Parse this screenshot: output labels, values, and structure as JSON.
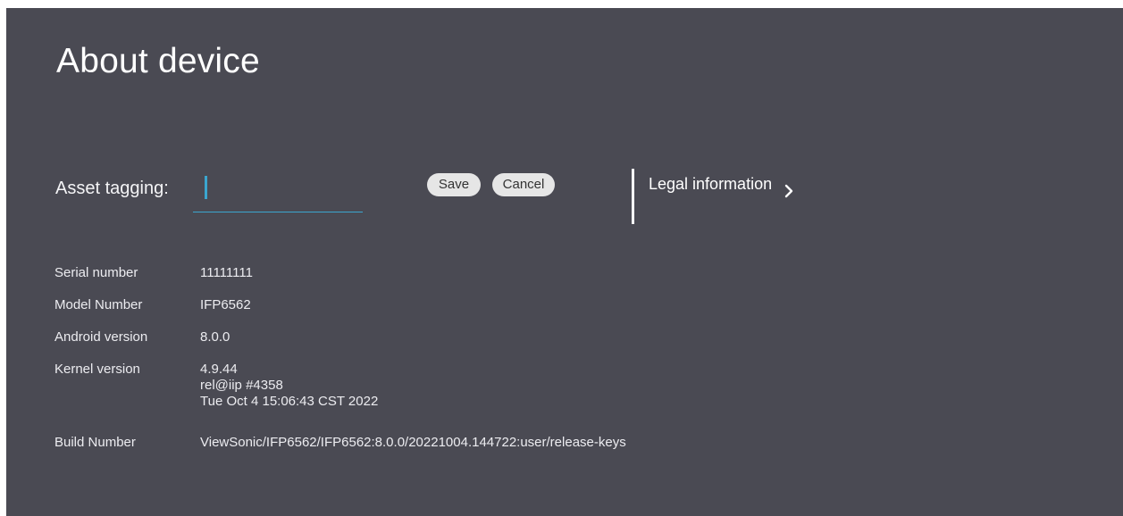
{
  "page": {
    "title": "About device"
  },
  "asset_tagging": {
    "label": "Asset tagging:",
    "value": "",
    "save_label": "Save",
    "cancel_label": "Cancel"
  },
  "legal": {
    "label": "Legal information"
  },
  "device_info": [
    {
      "key": "Serial number",
      "value": [
        "11111111"
      ]
    },
    {
      "key": "Model Number",
      "value": [
        "IFP6562"
      ]
    },
    {
      "key": "Android version",
      "value": [
        "8.0.0"
      ]
    },
    {
      "key": "Kernel version",
      "value": [
        "4.9.44",
        "rel@iip #4358",
        "Tue Oct 4 15:06:43 CST 2022"
      ]
    },
    {
      "key": "Build Number",
      "value": [
        "ViewSonic/IFP6562/IFP6562:8.0.0/20221004.144722:user/release-keys"
      ]
    }
  ],
  "colors": {
    "background": "#4a4a53",
    "accent": "#3ba6cf",
    "button_bg": "#e6e6e6"
  },
  "icons": {
    "legal_chevron": "chevron-right-icon"
  }
}
